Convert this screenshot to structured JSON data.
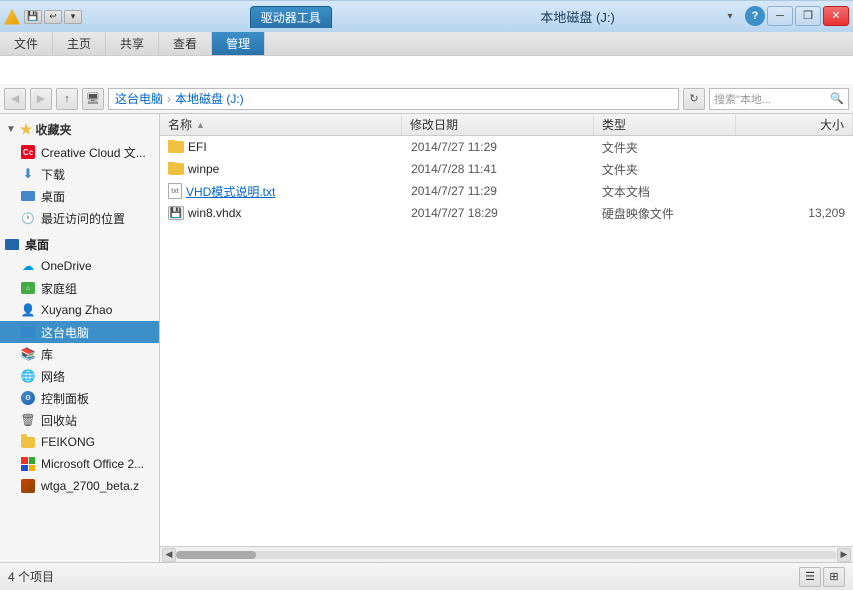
{
  "titlebar": {
    "app_icon": "folder",
    "qs_bttons": [
      "save",
      "undo",
      "customize"
    ],
    "tab_driver": "驱动器工具",
    "title": "本地磁盘 (J:)",
    "btn_min": "─",
    "btn_restore": "❒",
    "btn_close": "✕"
  },
  "ribbon": {
    "tabs": [
      {
        "id": "file",
        "label": "文件"
      },
      {
        "id": "home",
        "label": "主页"
      },
      {
        "id": "share",
        "label": "共享"
      },
      {
        "id": "view",
        "label": "查看"
      },
      {
        "id": "manage",
        "label": "管理",
        "active": true
      }
    ],
    "manage_buttons": [],
    "dropdown_arrow": "▾",
    "help_label": "?"
  },
  "addressbar": {
    "back_tooltip": "后退",
    "forward_tooltip": "前进",
    "up_tooltip": "向上",
    "path_parts": [
      {
        "label": "这台电脑"
      },
      {
        "label": "本地磁盘 (J:)"
      }
    ],
    "refresh_tooltip": "刷新",
    "search_placeholder": "搜索\"本地...",
    "search_icon": "🔍"
  },
  "sidebar": {
    "sections": [
      {
        "id": "favorites",
        "header": "收藏夹",
        "icon": "star",
        "items": [
          {
            "id": "cc",
            "label": "Creative Cloud 文...",
            "icon": "cc"
          },
          {
            "id": "download",
            "label": "下载",
            "icon": "download"
          },
          {
            "id": "desktop-fav",
            "label": "桌面",
            "icon": "desktop-small"
          },
          {
            "id": "recent",
            "label": "最近访问的位置",
            "icon": "recent"
          }
        ]
      },
      {
        "id": "desktop",
        "header": "桌面",
        "icon": "desktop-blue",
        "items": [
          {
            "id": "onedrive",
            "label": "OneDrive",
            "icon": "onedrive"
          },
          {
            "id": "homegroup",
            "label": "家庭组",
            "icon": "homegroup"
          },
          {
            "id": "user",
            "label": "Xuyang Zhao",
            "icon": "user"
          },
          {
            "id": "thispc",
            "label": "这台电脑",
            "icon": "thispc",
            "selected": true
          },
          {
            "id": "lib",
            "label": "库",
            "icon": "lib"
          },
          {
            "id": "network",
            "label": "网络",
            "icon": "globe"
          },
          {
            "id": "control",
            "label": "控制面板",
            "icon": "control"
          },
          {
            "id": "trash",
            "label": "回收站",
            "icon": "trash"
          },
          {
            "id": "feikong",
            "label": "FEIKONG",
            "icon": "folder-yellow"
          },
          {
            "id": "msoffice",
            "label": "Microsoft Office 2...",
            "icon": "ms"
          },
          {
            "id": "wtga",
            "label": "wtga_2700_beta.z",
            "icon": "wtga"
          }
        ]
      }
    ]
  },
  "content": {
    "columns": [
      {
        "id": "name",
        "label": "名称",
        "sort_arrow": "▲"
      },
      {
        "id": "date",
        "label": "修改日期"
      },
      {
        "id": "type",
        "label": "类型"
      },
      {
        "id": "size",
        "label": "大小"
      }
    ],
    "files": [
      {
        "name": "EFI",
        "date": "2014/7/27 11:29",
        "type": "文件夹",
        "size": "",
        "icon": "folder"
      },
      {
        "name": "winpe",
        "date": "2014/7/28 11:41",
        "type": "文件夹",
        "size": "",
        "icon": "folder"
      },
      {
        "name": "VHD模式说明.txt",
        "date": "2014/7/27 11:29",
        "type": "文本文档",
        "size": "",
        "icon": "txt"
      },
      {
        "name": "win8.vhdx",
        "date": "2014/7/27 18:29",
        "type": "硬盘映像文件",
        "size": "13,209",
        "icon": "vhd"
      }
    ]
  },
  "statusbar": {
    "count_text": "4 个项目",
    "view_detail": "☰",
    "view_large": "⊞"
  }
}
